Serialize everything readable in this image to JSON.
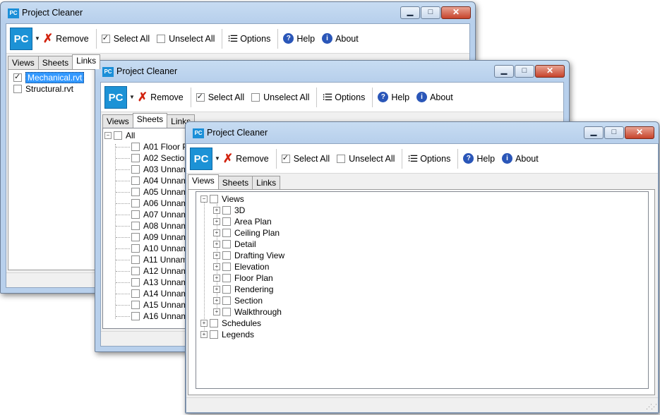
{
  "app_title": "Project Cleaner",
  "app_icon": "PC",
  "toolbar": {
    "logo": "PC",
    "remove": "Remove",
    "select_all": "Select All",
    "unselect_all": "Unselect All",
    "options": "Options",
    "help": "Help",
    "about": "About"
  },
  "tabs": {
    "views": "Views",
    "sheets": "Sheets",
    "links": "Links"
  },
  "window1": {
    "links": [
      {
        "label": "Mechanical.rvt",
        "checked": true,
        "selected": true
      },
      {
        "label": "Structural.rvt",
        "checked": false,
        "selected": false
      }
    ]
  },
  "window2": {
    "root": "All",
    "sheets": [
      "A01 Floor P",
      "A02 Section",
      "A03 Unnam",
      "A04 Unnam",
      "A05 Unnam",
      "A06 Unnam",
      "A07 Unnam",
      "A08 Unnam",
      "A09 Unnam",
      "A10 Unnam",
      "A11 Unnam",
      "A12 Unnam",
      "A13 Unnam",
      "A14 Unnam",
      "A15 Unnam",
      "A16 Unnam"
    ]
  },
  "window3": {
    "root": "Views",
    "view_types": [
      "3D",
      "Area Plan",
      "Ceiling Plan",
      "Detail",
      "Drafting View",
      "Elevation",
      "Floor Plan",
      "Rendering",
      "Section",
      "Walkthrough"
    ],
    "other_roots": [
      "Schedules",
      "Legends"
    ]
  },
  "icons": {
    "remove": "x-icon",
    "options": "list-icon",
    "help": "help-icon",
    "about": "info-icon",
    "expand": "plus-box-icon",
    "collapse": "minus-box-icon"
  },
  "colors": {
    "title_bar": "#b8d0ec",
    "close_button": "#c7432b",
    "logo_blue": "#1c92d6",
    "selection": "#3399ff"
  }
}
